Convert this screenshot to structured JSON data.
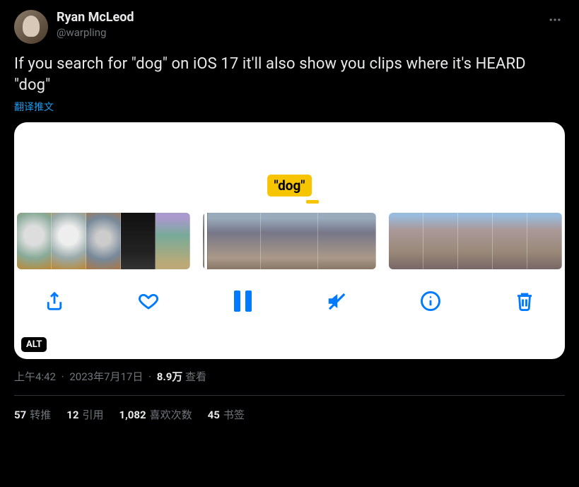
{
  "author": {
    "display_name": "Ryan McLeod",
    "handle": "@warpling"
  },
  "tweet_text": "If you search for \"dog\" on iOS 17 it'll also show you clips where it's HEARD \"dog\"",
  "translate_label": "翻译推文",
  "image": {
    "search_pill": "\"dog\"",
    "alt_badge": "ALT"
  },
  "meta": {
    "time": "上午4:42",
    "date": "2023年7月17日",
    "views_count": "8.9万",
    "views_label": "查看"
  },
  "stats": {
    "retweets_n": "57",
    "retweets_label": "转推",
    "quotes_n": "12",
    "quotes_label": "引用",
    "likes_n": "1,082",
    "likes_label": "喜欢次数",
    "bookmarks_n": "45",
    "bookmarks_label": "书签"
  }
}
